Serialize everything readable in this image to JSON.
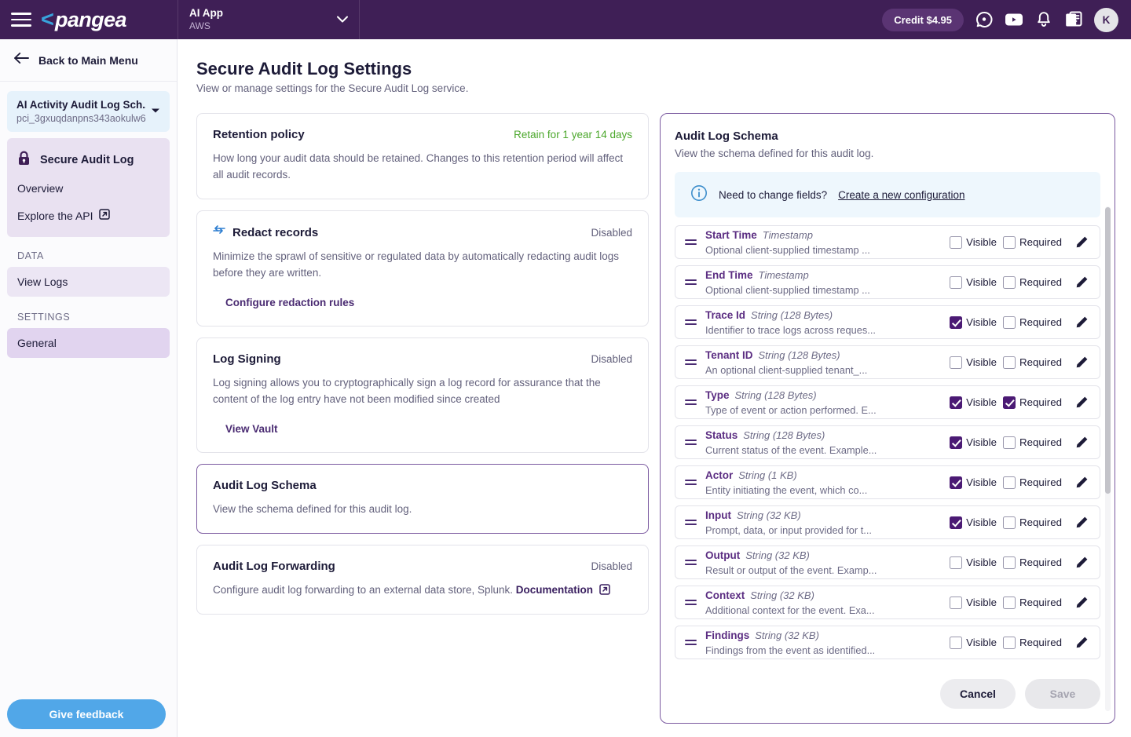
{
  "topbar": {
    "menu_icon": "hamburger-icon",
    "brand_mark": "<",
    "brand_text": "pangea",
    "project": {
      "name": "AI App",
      "cloud": "AWS"
    },
    "credit_label": "Credit $4.95",
    "icons": [
      "chat-icon",
      "youtube-icon",
      "bell-icon",
      "docs-icon"
    ],
    "avatar_initial": "K"
  },
  "sidebar": {
    "back_label": "Back to Main Menu",
    "project_card": {
      "title": "AI Activity Audit Log Sch...",
      "id": "pci_3gxuqdanpns343aokulw6..."
    },
    "service": {
      "title": "Secure Audit Log",
      "items": [
        {
          "label": "Overview",
          "external": false
        },
        {
          "label": "Explore the API",
          "external": true
        }
      ]
    },
    "sections": [
      {
        "label": "DATA",
        "items": [
          {
            "label": "View Logs",
            "state": "tinted"
          }
        ]
      },
      {
        "label": "SETTINGS",
        "items": [
          {
            "label": "General",
            "state": "active"
          }
        ]
      }
    ],
    "feedback_label": "Give feedback"
  },
  "page": {
    "title": "Secure Audit Log Settings",
    "subtitle": "View or manage settings for the Secure Audit Log service."
  },
  "cards": [
    {
      "title": "Retention policy",
      "status": "Retain for 1 year 14 days",
      "status_style": "green",
      "description": "How long your audit data should be retained. Changes to this retention period will affect all audit records.",
      "link": "",
      "icon": "",
      "selected": false
    },
    {
      "title": "Redact records",
      "status": "Disabled",
      "status_style": "muted",
      "description": "Minimize the sprawl of sensitive or regulated data by automatically redacting audit logs before they are written.",
      "link": "Configure redaction rules",
      "icon": "redact-arrows-icon",
      "selected": false
    },
    {
      "title": "Log Signing",
      "status": "Disabled",
      "status_style": "muted",
      "description": "Log signing allows you to cryptographically sign a log record for assurance that the content of the log entry have not been modified since created",
      "link": "View Vault",
      "icon": "",
      "selected": false
    },
    {
      "title": "Audit Log Schema",
      "status": "",
      "status_style": "muted",
      "description": "View the schema defined for this audit log.",
      "link": "",
      "icon": "",
      "selected": true
    },
    {
      "title": "Audit Log Forwarding",
      "status": "Disabled",
      "status_style": "muted",
      "description": "Configure audit log forwarding to an external data store, Splunk.",
      "description_link": "Documentation",
      "link": "",
      "icon": "",
      "selected": false
    }
  ],
  "schema_panel": {
    "title": "Audit Log Schema",
    "subtitle": "View the schema defined for this audit log.",
    "info": {
      "icon": "info-circle-icon",
      "text": "Need to change fields?",
      "link": "Create a new configuration"
    },
    "column_labels": {
      "visible": "Visible",
      "required": "Required"
    },
    "fields": [
      {
        "name": "Start Time",
        "type": "Timestamp",
        "description": "Optional client-supplied timestamp ...",
        "visible": false,
        "required": false
      },
      {
        "name": "End Time",
        "type": "Timestamp",
        "description": "Optional client-supplied timestamp ...",
        "visible": false,
        "required": false
      },
      {
        "name": "Trace Id",
        "type": "String (128 Bytes)",
        "description": "Identifier to trace logs across reques...",
        "visible": true,
        "required": false
      },
      {
        "name": "Tenant ID",
        "type": "String (128 Bytes)",
        "description": "An optional client-supplied tenant_...",
        "visible": false,
        "required": false
      },
      {
        "name": "Type",
        "type": "String (128 Bytes)",
        "description": "Type of event or action performed. E...",
        "visible": true,
        "required": true
      },
      {
        "name": "Status",
        "type": "String (128 Bytes)",
        "description": "Current status of the event. Example...",
        "visible": true,
        "required": false
      },
      {
        "name": "Actor",
        "type": "String (1 KB)",
        "description": "Entity initiating the event, which co...",
        "visible": true,
        "required": false
      },
      {
        "name": "Input",
        "type": "String (32 KB)",
        "description": "Prompt, data, or input provided for t...",
        "visible": true,
        "required": false
      },
      {
        "name": "Output",
        "type": "String (32 KB)",
        "description": "Result or output of the event. Examp...",
        "visible": false,
        "required": false
      },
      {
        "name": "Context",
        "type": "String (32 KB)",
        "description": "Additional context for the event. Exa...",
        "visible": false,
        "required": false
      },
      {
        "name": "Findings",
        "type": "String (32 KB)",
        "description": "Findings from the event as identified...",
        "visible": false,
        "required": false
      }
    ],
    "cancel_label": "Cancel",
    "save_label": "Save"
  },
  "colors": {
    "header_purple": "#3f1f56",
    "accent_purple": "#4b1a74",
    "field_name_purple": "#5b2d82",
    "green": "#4ba72b",
    "feedback_blue": "#51a7e8",
    "info_blue_bg": "#eef7fd"
  }
}
